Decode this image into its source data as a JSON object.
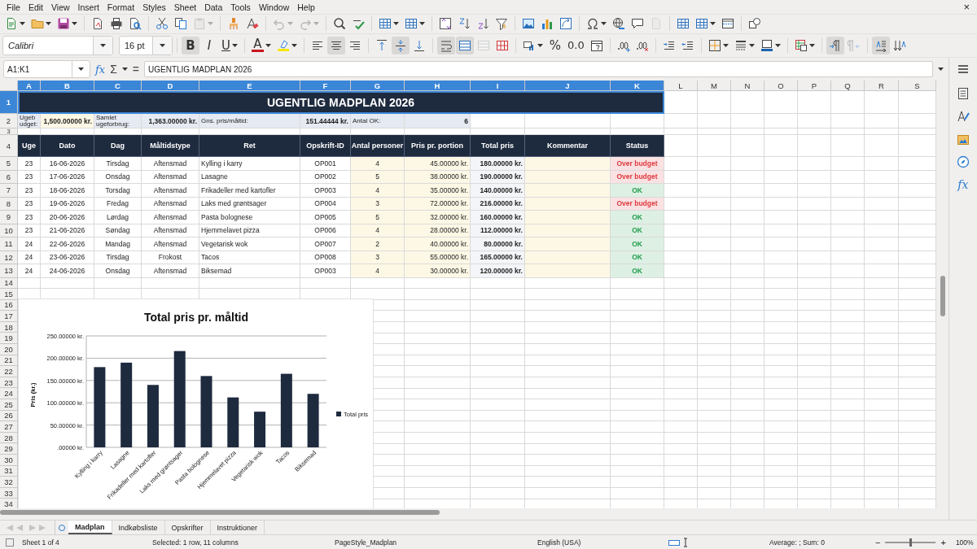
{
  "menu_bar": {
    "items": [
      "File",
      "Edit",
      "View",
      "Insert",
      "Format",
      "Styles",
      "Sheet",
      "Data",
      "Tools",
      "Window",
      "Help"
    ],
    "close": "×"
  },
  "toolbar_1": [
    {
      "kind": "new",
      "dropdown": true,
      "disabled": false
    },
    {
      "kind": "open",
      "dropdown": true,
      "disabled": false
    },
    {
      "kind": "save",
      "dropdown": true,
      "disabled": false
    },
    {
      "kind": "separator"
    },
    {
      "kind": "export-pdf",
      "disabled": false
    },
    {
      "kind": "print",
      "disabled": false
    },
    {
      "kind": "print-preview",
      "disabled": false
    },
    {
      "kind": "separator"
    },
    {
      "kind": "cut",
      "disabled": false
    },
    {
      "kind": "copy",
      "disabled": false
    },
    {
      "kind": "paste",
      "dropdown": true,
      "disabled": true
    },
    {
      "kind": "separator"
    },
    {
      "kind": "clone-formatting",
      "disabled": false
    },
    {
      "kind": "clear-formatting",
      "disabled": false
    },
    {
      "kind": "separator"
    },
    {
      "kind": "undo",
      "dropdown": true,
      "disabled": true
    },
    {
      "kind": "redo",
      "dropdown": true,
      "disabled": true
    },
    {
      "kind": "separator"
    },
    {
      "kind": "find-replace",
      "disabled": false
    },
    {
      "kind": "spelling",
      "disabled": false
    },
    {
      "kind": "separator"
    },
    {
      "kind": "insert-row",
      "dropdown": true,
      "disabled": false
    },
    {
      "kind": "insert-column",
      "dropdown": true,
      "disabled": false
    },
    {
      "kind": "separator"
    },
    {
      "kind": "sort",
      "disabled": false
    },
    {
      "kind": "sort-ascending",
      "disabled": false
    },
    {
      "kind": "sort-descending",
      "disabled": false
    },
    {
      "kind": "autofilter",
      "disabled": false
    },
    {
      "kind": "separator"
    },
    {
      "kind": "insert-image",
      "disabled": false
    },
    {
      "kind": "insert-chart",
      "disabled": false
    },
    {
      "kind": "pivot-table",
      "disabled": false
    },
    {
      "kind": "separator"
    },
    {
      "kind": "special-character",
      "dropdown": true,
      "disabled": false
    },
    {
      "kind": "hyperlink",
      "disabled": false
    },
    {
      "kind": "comment",
      "disabled": false
    },
    {
      "kind": "header-footer",
      "disabled": true
    },
    {
      "kind": "separator"
    },
    {
      "kind": "print-area",
      "disabled": false
    },
    {
      "kind": "freeze",
      "dropdown": true,
      "disabled": false
    },
    {
      "kind": "split-window",
      "disabled": false
    },
    {
      "kind": "separator"
    },
    {
      "kind": "shapes",
      "disabled": false
    }
  ],
  "toolbar_2": [
    {
      "kind": "font-name",
      "value": "Calibri"
    },
    {
      "kind": "font-size",
      "value": "16 pt"
    },
    {
      "kind": "separator"
    },
    {
      "kind": "bold",
      "label": "B",
      "pressed": true,
      "disabled": false
    },
    {
      "kind": "italic",
      "label": "I",
      "pressed": false,
      "disabled": false
    },
    {
      "kind": "underline",
      "label": "U",
      "dropdown": true,
      "pressed": false,
      "disabled": false
    },
    {
      "kind": "separator"
    },
    {
      "kind": "font-color",
      "label": "A",
      "dropdown": true,
      "pressed": false,
      "disabled": false
    },
    {
      "kind": "highlight",
      "dropdown": true,
      "pressed": false,
      "disabled": false
    },
    {
      "kind": "separator"
    },
    {
      "kind": "align-left",
      "pressed": false,
      "disabled": false
    },
    {
      "kind": "align-center",
      "pressed": true,
      "disabled": false
    },
    {
      "kind": "align-right",
      "pressed": false,
      "disabled": false
    },
    {
      "kind": "separator"
    },
    {
      "kind": "align-top",
      "pressed": false,
      "disabled": false
    },
    {
      "kind": "align-middle",
      "pressed": true,
      "disabled": false
    },
    {
      "kind": "align-bottom",
      "pressed": false,
      "disabled": false
    },
    {
      "kind": "separator"
    },
    {
      "kind": "wrap-text",
      "pressed": true,
      "disabled": false
    },
    {
      "kind": "merge-center",
      "pressed": true,
      "disabled": false
    },
    {
      "kind": "merge",
      "pressed": false,
      "disabled": true
    },
    {
      "kind": "unmerge",
      "pressed": false,
      "disabled": false
    },
    {
      "kind": "separator"
    },
    {
      "kind": "number-format",
      "dropdown": true,
      "pressed": false,
      "disabled": false
    },
    {
      "kind": "percent",
      "label": "%",
      "pressed": false,
      "disabled": false
    },
    {
      "kind": "decimal",
      "label": "0.0",
      "pressed": false,
      "disabled": false
    },
    {
      "kind": "date",
      "pressed": false,
      "disabled": false
    },
    {
      "kind": "separator"
    },
    {
      "kind": "add-decimal",
      "pressed": false,
      "disabled": false
    },
    {
      "kind": "delete-decimal",
      "pressed": false,
      "disabled": false
    },
    {
      "kind": "separator"
    },
    {
      "kind": "indent-increase",
      "pressed": false,
      "disabled": false
    },
    {
      "kind": "indent-decrease",
      "pressed": false,
      "disabled": false
    },
    {
      "kind": "separator"
    },
    {
      "kind": "borders",
      "dropdown": true,
      "pressed": false,
      "disabled": false
    },
    {
      "kind": "border-style",
      "dropdown": true,
      "pressed": false,
      "disabled": false
    },
    {
      "kind": "border-color",
      "dropdown": true,
      "pressed": false,
      "disabled": false
    },
    {
      "kind": "separator"
    },
    {
      "kind": "conditional",
      "dropdown": true,
      "pressed": false,
      "disabled": false
    },
    {
      "kind": "separator"
    },
    {
      "kind": "left-to-right",
      "pressed": true,
      "disabled": false
    },
    {
      "kind": "right-to-left",
      "pressed": false,
      "disabled": true
    },
    {
      "kind": "separator"
    },
    {
      "kind": "text-left-right",
      "pressed": true,
      "disabled": false
    },
    {
      "kind": "text-top-bottom",
      "pressed": false,
      "disabled": false
    }
  ],
  "formula_bar": {
    "name_box": "A1:K1",
    "function_wizard": "fx",
    "sum": "Σ",
    "equals": "=",
    "content": "UGENTLIG MADPLAN 2026"
  },
  "sheet": {
    "columns": [
      {
        "label": "A",
        "selected": true
      },
      {
        "label": "B",
        "selected": true
      },
      {
        "label": "C",
        "selected": true
      },
      {
        "label": "D",
        "selected": true
      },
      {
        "label": "E",
        "selected": true
      },
      {
        "label": "F",
        "selected": true
      },
      {
        "label": "G",
        "selected": true
      },
      {
        "label": "H",
        "selected": true
      },
      {
        "label": "I",
        "selected": true
      },
      {
        "label": "J",
        "selected": true
      },
      {
        "label": "K",
        "selected": true
      },
      {
        "label": "L",
        "selected": false
      },
      {
        "label": "M",
        "selected": false
      },
      {
        "label": "N",
        "selected": false
      },
      {
        "label": "O",
        "selected": false
      },
      {
        "label": "P",
        "selected": false
      },
      {
        "label": "Q",
        "selected": false
      },
      {
        "label": "R",
        "selected": false
      },
      {
        "label": "S",
        "selected": false
      }
    ],
    "rows": [
      {
        "label": "1",
        "selected": true
      },
      {
        "label": "2",
        "selected": false
      },
      {
        "label": "3",
        "selected": false
      },
      {
        "label": "4",
        "selected": false
      },
      {
        "label": "5",
        "selected": false
      },
      {
        "label": "6",
        "selected": false
      },
      {
        "label": "7",
        "selected": false
      },
      {
        "label": "8",
        "selected": false
      },
      {
        "label": "9",
        "selected": false
      },
      {
        "label": "10",
        "selected": false
      },
      {
        "label": "11",
        "selected": false
      },
      {
        "label": "12",
        "selected": false
      },
      {
        "label": "13",
        "selected": false
      },
      {
        "label": "14",
        "selected": false
      },
      {
        "label": "15",
        "selected": false
      },
      {
        "label": "16",
        "selected": false
      },
      {
        "label": "17",
        "selected": false
      },
      {
        "label": "18",
        "selected": false
      },
      {
        "label": "19",
        "selected": false
      },
      {
        "label": "20",
        "selected": false
      },
      {
        "label": "21",
        "selected": false
      },
      {
        "label": "22",
        "selected": false
      },
      {
        "label": "23",
        "selected": false
      },
      {
        "label": "24",
        "selected": false
      },
      {
        "label": "25",
        "selected": false
      },
      {
        "label": "26",
        "selected": false
      },
      {
        "label": "27",
        "selected": false
      },
      {
        "label": "28",
        "selected": false
      },
      {
        "label": "29",
        "selected": false
      },
      {
        "label": "30",
        "selected": false
      },
      {
        "label": "31",
        "selected": false
      },
      {
        "label": "32",
        "selected": false
      },
      {
        "label": "33",
        "selected": false
      },
      {
        "label": "34",
        "selected": false
      }
    ],
    "title": "UGENTLIG MADPLAN 2026",
    "summary": [
      {
        "label": "Ugebudget:",
        "value": "1,500.00000 kr."
      },
      {
        "label": "Samlet ugeforbrug:",
        "value": "1,363.00000 kr."
      },
      {
        "label": "Gns. pris/måltid:",
        "value": "151.44444 kr."
      },
      {
        "label": "Antal OK:",
        "value": "6"
      }
    ],
    "table_headers": [
      "Uge",
      "Dato",
      "Dag",
      "Måltidstype",
      "Ret",
      "Opskrift-ID",
      "Antal personer",
      "Pris pr. portion",
      "Total pris",
      "Kommentar",
      "Status"
    ],
    "table_rows": [
      {
        "cells": [
          "23",
          "16-06-2026",
          "Tirsdag",
          "Aftensmad",
          "Kylling i karry",
          "OP001",
          "4",
          "45.00000 kr.",
          "180.00000 kr."
        ],
        "status": "Over budget",
        "color": "#e0393e"
      },
      {
        "cells": [
          "23",
          "17-06-2026",
          "Onsdag",
          "Aftensmad",
          "Lasagne",
          "OP002",
          "5",
          "38.00000 kr.",
          "190.00000 kr."
        ],
        "status": "Over budget",
        "color": "#e0393e"
      },
      {
        "cells": [
          "23",
          "18-06-2026",
          "Torsdag",
          "Aftensmad",
          "Frikadeller med kartofler",
          "OP003",
          "4",
          "35.00000 kr.",
          "140.00000 kr."
        ],
        "status": "OK",
        "color": "#1f9d4c"
      },
      {
        "cells": [
          "23",
          "19-06-2026",
          "Fredag",
          "Aftensmad",
          "Laks med grøntsager",
          "OP004",
          "3",
          "72.00000 kr.",
          "216.00000 kr."
        ],
        "status": "Over budget",
        "color": "#e0393e"
      },
      {
        "cells": [
          "23",
          "20-06-2026",
          "Lørdag",
          "Aftensmad",
          "Pasta bolognese",
          "OP005",
          "5",
          "32.00000 kr.",
          "160.00000 kr."
        ],
        "status": "OK",
        "color": "#1f9d4c"
      },
      {
        "cells": [
          "23",
          "21-06-2026",
          "Søndag",
          "Aftensmad",
          "Hjemmelavet pizza",
          "OP006",
          "4",
          "28.00000 kr.",
          "112.00000 kr."
        ],
        "status": "OK",
        "color": "#1f9d4c"
      },
      {
        "cells": [
          "24",
          "22-06-2026",
          "Mandag",
          "Aftensmad",
          "Vegetarisk wok",
          "OP007",
          "2",
          "40.00000 kr.",
          "80.00000 kr."
        ],
        "status": "OK",
        "color": "#1f9d4c"
      },
      {
        "cells": [
          "24",
          "23-06-2026",
          "Tirsdag",
          "Frokost",
          "Tacos",
          "OP008",
          "3",
          "55.00000 kr.",
          "165.00000 kr."
        ],
        "status": "OK",
        "color": "#1f9d4c"
      },
      {
        "cells": [
          "24",
          "24-06-2026",
          "Onsdag",
          "Aftensmad",
          "Biksemad",
          "OP003",
          "4",
          "30.00000 kr.",
          "120.00000 kr."
        ],
        "status": "OK",
        "color": "#1f9d4c"
      }
    ],
    "chart": {
      "chart_data": {
        "type": "bar",
        "title": "Total pris pr. måltid",
        "ylabel": "Pris (kr.)",
        "categories": [
          "Kylling i karry",
          "Lasagne",
          "Frikadeller med kartofler",
          "Laks med grøntsager",
          "Pasta bolognese",
          "Hjemmelavet pizza",
          "Vegetarisk wok",
          "Tacos",
          "Biksemad"
        ],
        "series": [
          {
            "name": "Total pris",
            "color": "#1e2a3e",
            "values": [
              180,
              190,
              140,
              216,
              160,
              112,
              80,
              165,
              120
            ]
          }
        ],
        "ylim": [
          0,
          250
        ],
        "grid": true,
        "yticks": [
          {
            "value": 0,
            "label": ".00000 kr."
          },
          {
            "value": 50,
            "label": "50.00000 kr."
          },
          {
            "value": 100,
            "label": "100.00000 kr."
          },
          {
            "value": 150,
            "label": "150.00000 kr."
          },
          {
            "value": 200,
            "label": "200.00000 kr."
          },
          {
            "value": 250,
            "label": "250.00000 kr."
          }
        ]
      }
    }
  },
  "sheet_tabs": [
    {
      "label": "Madplan",
      "selected": true
    },
    {
      "label": "Indkøbsliste",
      "selected": false
    },
    {
      "label": "Opskrifter",
      "selected": false
    },
    {
      "label": "Instruktioner",
      "selected": false
    }
  ],
  "status_bar": {
    "sheet": "Sheet 1 of 4",
    "selection": "Selected: 1 row, 11 columns",
    "page_style": "PageStyle_Madplan",
    "language": "English (USA)",
    "summary": "Average: ; Sum: 0",
    "zoom": {
      "minus": "−",
      "plus": "+",
      "level": 0.5,
      "value": "100%"
    }
  },
  "sidebar": {
    "function_label": "fx"
  }
}
